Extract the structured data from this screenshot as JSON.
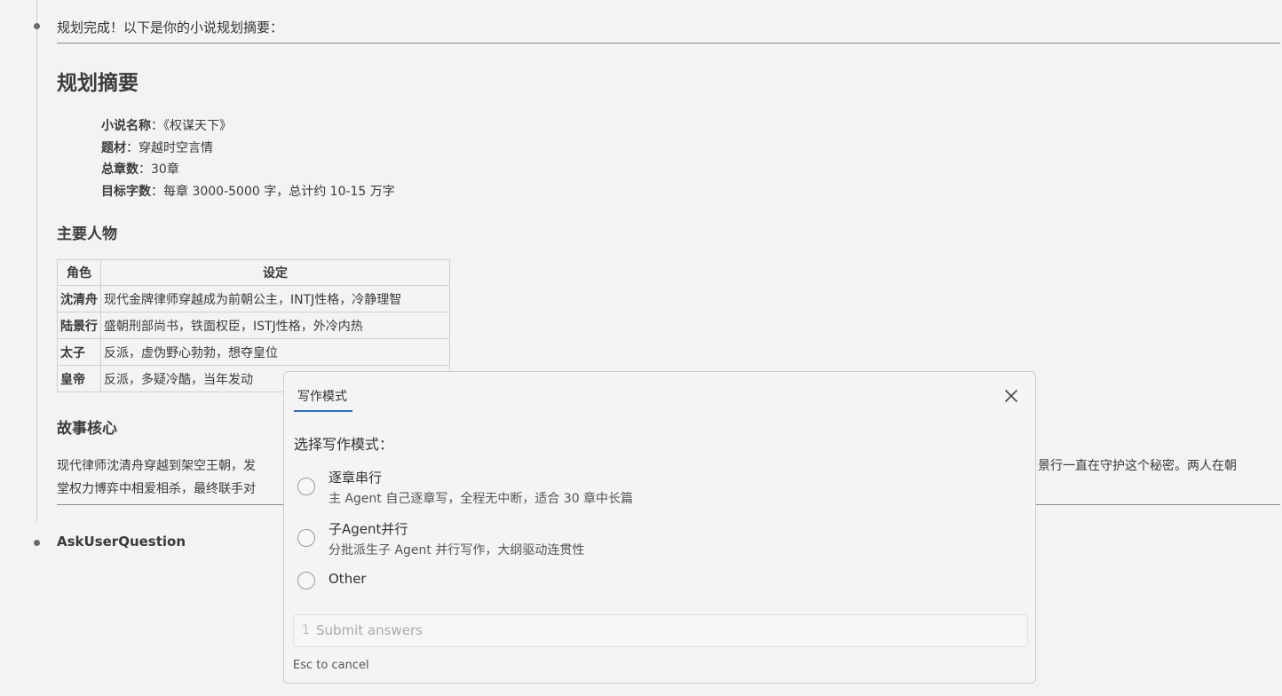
{
  "chat": {
    "intro": "规划完成！以下是你的小说规划摘要：",
    "heading": "规划摘要",
    "summary": [
      {
        "label": "小说名称",
        "value": "：《权谋天下》"
      },
      {
        "label": "题材",
        "value": "：穿越时空言情"
      },
      {
        "label": "总章数",
        "value": "：30章"
      },
      {
        "label": "目标字数",
        "value": "：每章 3000-5000 字，总计约 10-15 万字"
      }
    ],
    "characters_heading": "主要人物",
    "table": {
      "headers": [
        "角色",
        "设定"
      ],
      "rows": [
        [
          "沈清舟",
          "现代金牌律师穿越成为前朝公主，INTJ性格，冷静理智"
        ],
        [
          "陆景行",
          "盛朝刑部尚书，铁面权臣，ISTJ性格，外冷内热"
        ],
        [
          "太子",
          "反派，虚伪野心勃勃，想夺皇位"
        ],
        [
          "皇帝",
          "反派，多疑冷酷，当年发动"
        ]
      ]
    },
    "core_heading": "故事核心",
    "story_line1_left": "现代律师沈清舟穿越到架空王朝，发",
    "story_line1_right": "景行一直在守护这个秘密。两人在朝",
    "story_line2_left": "堂权力博弈中相爱相杀，最终联手对",
    "tool_name": "AskUserQuestion"
  },
  "modal": {
    "tab_label": "写作模式",
    "question": "选择写作模式：",
    "options": [
      {
        "label": "逐章串行",
        "desc": "主 Agent 自己逐章写，全程无中断，适合 30 章中长篇"
      },
      {
        "label": "子Agent并行",
        "desc": "分批派生子 Agent 并行写作，大纲驱动连贯性"
      },
      {
        "label": "Other",
        "desc": ""
      }
    ],
    "submit_number": "1",
    "submit_label": "Submit answers",
    "esc_hint": "Esc to cancel",
    "accent_color": "#2a6fc9"
  },
  "icons": {
    "close": "close-icon",
    "timeline_dot": "timeline-dot-icon"
  }
}
